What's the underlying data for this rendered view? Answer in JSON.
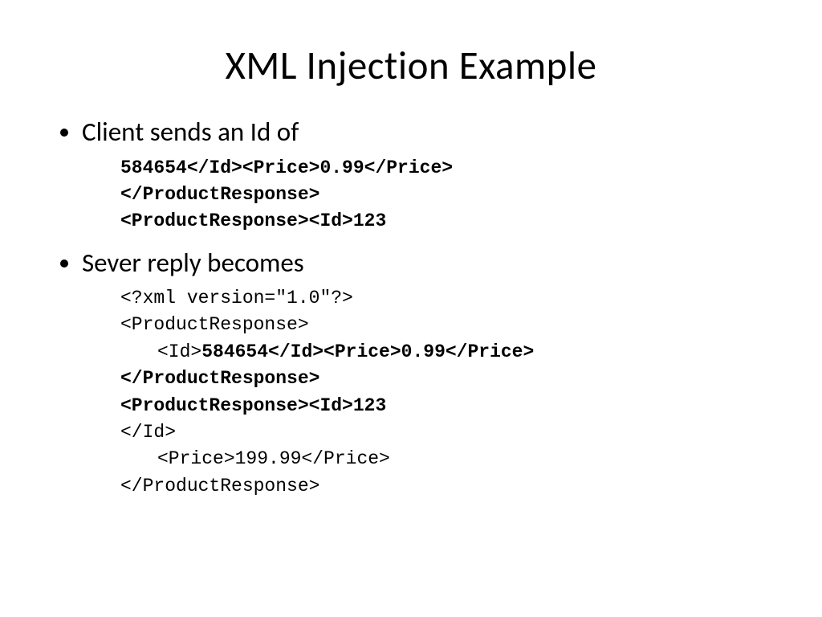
{
  "title": "XML Injection Example",
  "bullets": {
    "b1": "Client sends an Id of",
    "b2": "Sever reply becomes"
  },
  "client_code": {
    "l1": "584654</Id><Price>0.99</Price>",
    "l2": "</ProductResponse>",
    "l3": "<ProductResponse><Id>123"
  },
  "server_code": {
    "l1": "<?xml version=\"1.0\"?>",
    "l2": "<ProductResponse>",
    "l3_pre": "<Id>",
    "l3_bold": "584654</Id><Price>0.99</Price>",
    "l4": "</ProductResponse>",
    "l5": "<ProductResponse><Id>123",
    "l6": "</Id>",
    "l7": "<Price>199.99</Price>",
    "l8": "</ProductResponse>"
  }
}
